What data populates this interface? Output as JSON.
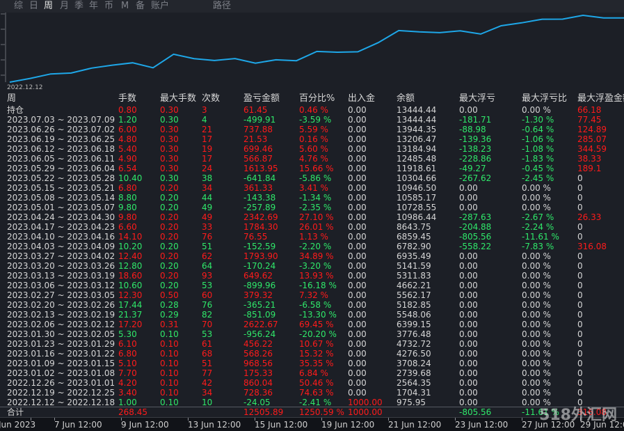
{
  "tabs": [
    {
      "label": "综",
      "active": false
    },
    {
      "label": "日",
      "active": false
    },
    {
      "label": "周",
      "active": true
    },
    {
      "label": "月",
      "active": false
    },
    {
      "label": "季",
      "active": false
    },
    {
      "label": "年",
      "active": false
    },
    {
      "label": "币",
      "active": false
    },
    {
      "label": "M",
      "active": false
    },
    {
      "label": "备",
      "active": false
    },
    {
      "label": "账户",
      "active": false
    },
    {
      "label": "路径",
      "active": false
    }
  ],
  "chart": {
    "start_label": "2022.12.12",
    "line_color": "#1ea7e8",
    "balances": [
      975.95,
      1704.31,
      2564.35,
      2739.68,
      3708.24,
      4276.5,
      4732.72,
      3776.48,
      6399.15,
      5548.06,
      5182.85,
      5562.17,
      4662.21,
      5311.83,
      5141.59,
      6935.49,
      6782.9,
      6859.45,
      8643.75,
      10986.44,
      10728.55,
      10585.17,
      10946.5,
      10304.66,
      11918.61,
      12485.48,
      13184.94,
      13206.47,
      13944.35,
      13444.44,
      13444.44
    ]
  },
  "columns": [
    "周",
    "手数",
    "最大手数",
    "次数",
    "盈亏金额",
    "百分比%",
    "出入金",
    "余额",
    "最大浮亏",
    "最大浮亏比",
    "最大浮盈金额"
  ],
  "rows": [
    {
      "period": "持仓",
      "lots": "0.80",
      "maxlots": "0.30",
      "count": "3",
      "pnl": "61.45",
      "pct": "0.46 %",
      "flow": "0.00",
      "balance": "13444.44",
      "maxloss": "0.00",
      "maxlosspct": "0.00 %",
      "maxprofit": "66.18",
      "tone": "red"
    },
    {
      "period": "2023.07.03 ~ 2023.07.09",
      "lots": "1.20",
      "maxlots": "0.30",
      "count": "4",
      "pnl": "-499.91",
      "pct": "-3.59 %",
      "flow": "0.00",
      "balance": "13444.44",
      "maxloss": "-181.71",
      "maxlosspct": "-1.30 %",
      "maxprofit": "77.45",
      "tone": "green"
    },
    {
      "period": "2023.06.26 ~ 2023.07.02",
      "lots": "6.00",
      "maxlots": "0.30",
      "count": "21",
      "pnl": "737.88",
      "pct": "5.59 %",
      "flow": "0.00",
      "balance": "13944.35",
      "maxloss": "-88.98",
      "maxlosspct": "-0.64 %",
      "maxprofit": "124.89",
      "tone": "red"
    },
    {
      "period": "2023.06.19 ~ 2023.06.25",
      "lots": "4.80",
      "maxlots": "0.30",
      "count": "17",
      "pnl": "21.53",
      "pct": "0.16 %",
      "flow": "0.00",
      "balance": "13206.47",
      "maxloss": "-139.36",
      "maxlosspct": "-1.06 %",
      "maxprofit": "285.07",
      "tone": "red"
    },
    {
      "period": "2023.06.12 ~ 2023.06.18",
      "lots": "5.40",
      "maxlots": "0.30",
      "count": "19",
      "pnl": "699.46",
      "pct": "5.60 %",
      "flow": "0.00",
      "balance": "13184.94",
      "maxloss": "-138.23",
      "maxlosspct": "-1.08 %",
      "maxprofit": "344.59",
      "tone": "red"
    },
    {
      "period": "2023.06.05 ~ 2023.06.11",
      "lots": "4.90",
      "maxlots": "0.30",
      "count": "17",
      "pnl": "566.87",
      "pct": "4.76 %",
      "flow": "0.00",
      "balance": "12485.48",
      "maxloss": "-228.86",
      "maxlosspct": "-1.83 %",
      "maxprofit": "38.33",
      "tone": "red"
    },
    {
      "period": "2023.05.29 ~ 2023.06.04",
      "lots": "6.54",
      "maxlots": "0.30",
      "count": "24",
      "pnl": "1613.95",
      "pct": "15.66 %",
      "flow": "0.00",
      "balance": "11918.61",
      "maxloss": "-49.27",
      "maxlosspct": "-0.45 %",
      "maxprofit": "189.1",
      "tone": "red"
    },
    {
      "period": "2023.05.22 ~ 2023.05.28",
      "lots": "10.40",
      "maxlots": "0.30",
      "count": "38",
      "pnl": "-641.84",
      "pct": "-5.86 %",
      "flow": "0.00",
      "balance": "10304.66",
      "maxloss": "-267.62",
      "maxlosspct": "-2.45 %",
      "maxprofit": "0",
      "tone": "green"
    },
    {
      "period": "2023.05.15 ~ 2023.05.21",
      "lots": "6.80",
      "maxlots": "0.20",
      "count": "34",
      "pnl": "361.33",
      "pct": "3.41 %",
      "flow": "0.00",
      "balance": "10946.50",
      "maxloss": "0.00",
      "maxlosspct": "0.00 %",
      "maxprofit": "0",
      "tone": "red"
    },
    {
      "period": "2023.05.08 ~ 2023.05.14",
      "lots": "8.80",
      "maxlots": "0.20",
      "count": "44",
      "pnl": "-143.38",
      "pct": "-1.34 %",
      "flow": "0.00",
      "balance": "10585.17",
      "maxloss": "0.00",
      "maxlosspct": "0.00 %",
      "maxprofit": "0",
      "tone": "green"
    },
    {
      "period": "2023.05.01 ~ 2023.05.07",
      "lots": "9.80",
      "maxlots": "0.20",
      "count": "49",
      "pnl": "-257.89",
      "pct": "-2.35 %",
      "flow": "0.00",
      "balance": "10728.55",
      "maxloss": "0.00",
      "maxlosspct": "0.00 %",
      "maxprofit": "0",
      "tone": "green"
    },
    {
      "period": "2023.04.24 ~ 2023.04.30",
      "lots": "9.80",
      "maxlots": "0.20",
      "count": "49",
      "pnl": "2342.69",
      "pct": "27.10 %",
      "flow": "0.00",
      "balance": "10986.44",
      "maxloss": "-287.63",
      "maxlosspct": "-2.67 %",
      "maxprofit": "26.33",
      "tone": "red"
    },
    {
      "period": "2023.04.17 ~ 2023.04.23",
      "lots": "6.60",
      "maxlots": "0.20",
      "count": "33",
      "pnl": "1784.30",
      "pct": "26.01 %",
      "flow": "0.00",
      "balance": "8643.75",
      "maxloss": "-204.88",
      "maxlosspct": "-2.24 %",
      "maxprofit": "0",
      "tone": "red"
    },
    {
      "period": "2023.04.10 ~ 2023.04.16",
      "lots": "14.10",
      "maxlots": "0.20",
      "count": "76",
      "pnl": "76.55",
      "pct": "1.13 %",
      "flow": "0.00",
      "balance": "6859.45",
      "maxloss": "-805.56",
      "maxlosspct": "-11.61 %",
      "maxprofit": "0",
      "tone": "red"
    },
    {
      "period": "2023.04.03 ~ 2023.04.09",
      "lots": "10.20",
      "maxlots": "0.20",
      "count": "51",
      "pnl": "-152.59",
      "pct": "-2.20 %",
      "flow": "0.00",
      "balance": "6782.90",
      "maxloss": "-558.22",
      "maxlosspct": "-7.83 %",
      "maxprofit": "316.08",
      "tone": "green"
    },
    {
      "period": "2023.03.27 ~ 2023.04.02",
      "lots": "12.40",
      "maxlots": "0.20",
      "count": "62",
      "pnl": "1793.90",
      "pct": "34.89 %",
      "flow": "0.00",
      "balance": "6935.49",
      "maxloss": "0.00",
      "maxlosspct": "0.00 %",
      "maxprofit": "0",
      "tone": "red"
    },
    {
      "period": "2023.03.20 ~ 2023.03.26",
      "lots": "12.80",
      "maxlots": "0.20",
      "count": "64",
      "pnl": "-170.24",
      "pct": "-3.20 %",
      "flow": "0.00",
      "balance": "5141.59",
      "maxloss": "0.00",
      "maxlosspct": "0.00 %",
      "maxprofit": "0",
      "tone": "green"
    },
    {
      "period": "2023.03.13 ~ 2023.03.19",
      "lots": "18.60",
      "maxlots": "0.20",
      "count": "93",
      "pnl": "649.62",
      "pct": "13.93 %",
      "flow": "0.00",
      "balance": "5311.83",
      "maxloss": "0.00",
      "maxlosspct": "0.00 %",
      "maxprofit": "0",
      "tone": "red"
    },
    {
      "period": "2023.03.06 ~ 2023.03.12",
      "lots": "10.60",
      "maxlots": "0.20",
      "count": "53",
      "pnl": "-899.96",
      "pct": "-16.18 %",
      "flow": "0.00",
      "balance": "4662.21",
      "maxloss": "0.00",
      "maxlosspct": "0.00 %",
      "maxprofit": "0",
      "tone": "green"
    },
    {
      "period": "2023.02.27 ~ 2023.03.05",
      "lots": "12.30",
      "maxlots": "0.50",
      "count": "60",
      "pnl": "379.32",
      "pct": "7.32 %",
      "flow": "0.00",
      "balance": "5562.17",
      "maxloss": "0.00",
      "maxlosspct": "0.00 %",
      "maxprofit": "0",
      "tone": "red"
    },
    {
      "period": "2023.02.20 ~ 2023.02.26",
      "lots": "17.44",
      "maxlots": "0.28",
      "count": "76",
      "pnl": "-365.21",
      "pct": "-6.58 %",
      "flow": "0.00",
      "balance": "5182.85",
      "maxloss": "0.00",
      "maxlosspct": "0.00 %",
      "maxprofit": "0",
      "tone": "green"
    },
    {
      "period": "2023.02.13 ~ 2023.02.19",
      "lots": "21.37",
      "maxlots": "0.29",
      "count": "82",
      "pnl": "-851.09",
      "pct": "-13.30 %",
      "flow": "0.00",
      "balance": "5548.06",
      "maxloss": "0.00",
      "maxlosspct": "0.00 %",
      "maxprofit": "0",
      "tone": "green"
    },
    {
      "period": "2023.02.06 ~ 2023.02.12",
      "lots": "17.20",
      "maxlots": "0.31",
      "count": "70",
      "pnl": "2622.67",
      "pct": "69.45 %",
      "flow": "0.00",
      "balance": "6399.15",
      "maxloss": "0.00",
      "maxlosspct": "0.00 %",
      "maxprofit": "0",
      "tone": "red"
    },
    {
      "period": "2023.01.30 ~ 2023.02.05",
      "lots": "5.30",
      "maxlots": "0.10",
      "count": "53",
      "pnl": "-956.24",
      "pct": "-20.20 %",
      "flow": "0.00",
      "balance": "3776.48",
      "maxloss": "0.00",
      "maxlosspct": "0.00 %",
      "maxprofit": "0",
      "tone": "green"
    },
    {
      "period": "2023.01.23 ~ 2023.01.29",
      "lots": "6.10",
      "maxlots": "0.10",
      "count": "61",
      "pnl": "456.22",
      "pct": "10.67 %",
      "flow": "0.00",
      "balance": "4732.72",
      "maxloss": "0.00",
      "maxlosspct": "0.00 %",
      "maxprofit": "0",
      "tone": "red"
    },
    {
      "period": "2023.01.16 ~ 2023.01.22",
      "lots": "6.80",
      "maxlots": "0.10",
      "count": "68",
      "pnl": "568.26",
      "pct": "15.32 %",
      "flow": "0.00",
      "balance": "4276.50",
      "maxloss": "0.00",
      "maxlosspct": "0.00 %",
      "maxprofit": "0",
      "tone": "red"
    },
    {
      "period": "2023.01.09 ~ 2023.01.15",
      "lots": "5.10",
      "maxlots": "0.10",
      "count": "51",
      "pnl": "968.56",
      "pct": "35.35 %",
      "flow": "0.00",
      "balance": "3708.24",
      "maxloss": "0.00",
      "maxlosspct": "0.00 %",
      "maxprofit": "0",
      "tone": "red"
    },
    {
      "period": "2023.01.02 ~ 2023.01.08",
      "lots": "7.70",
      "maxlots": "0.10",
      "count": "77",
      "pnl": "175.33",
      "pct": "6.84 %",
      "flow": "0.00",
      "balance": "2739.68",
      "maxloss": "0.00",
      "maxlosspct": "0.00 %",
      "maxprofit": "0",
      "tone": "red"
    },
    {
      "period": "2022.12.26 ~ 2023.01.01",
      "lots": "4.20",
      "maxlots": "0.10",
      "count": "42",
      "pnl": "860.04",
      "pct": "50.46 %",
      "flow": "0.00",
      "balance": "2564.35",
      "maxloss": "0.00",
      "maxlosspct": "0.00 %",
      "maxprofit": "0",
      "tone": "red"
    },
    {
      "period": "2022.12.19 ~ 2022.12.25",
      "lots": "3.40",
      "maxlots": "0.10",
      "count": "34",
      "pnl": "728.36",
      "pct": "74.63 %",
      "flow": "0.00",
      "balance": "1704.31",
      "maxloss": "0.00",
      "maxlosspct": "0.00 %",
      "maxprofit": "0",
      "tone": "red"
    },
    {
      "period": "2022.12.12 ~ 2022.12.18",
      "lots": "1.00",
      "maxlots": "0.10",
      "count": "10",
      "pnl": "-24.05",
      "pct": "-2.41 %",
      "flow": "1000.00",
      "balance": "975.95",
      "maxloss": "0.00",
      "maxlosspct": "0.00 %",
      "maxprofit": "0",
      "tone": "green"
    }
  ],
  "total": {
    "label": "合计",
    "lots": "268.45",
    "maxlots": "",
    "count": "",
    "pnl": "12505.89",
    "pct": "1250.59 %",
    "flow": "1000.00",
    "balance": "",
    "maxloss": "-805.56",
    "maxlosspct": "-11.61 %",
    "maxprofit": "316.08"
  },
  "xaxis": [
    "Jun 2023",
    "7 Jun 12:00",
    "9 Jun 12:00",
    "13 Jun 12:00",
    "15 Jun 12:00",
    "19 Jun 12:00",
    "21 Jun 12:00",
    "23 Jun 12:00",
    "27 Jun 12:00",
    "29 Jun 12:00"
  ],
  "watermark": "518外汇网"
}
